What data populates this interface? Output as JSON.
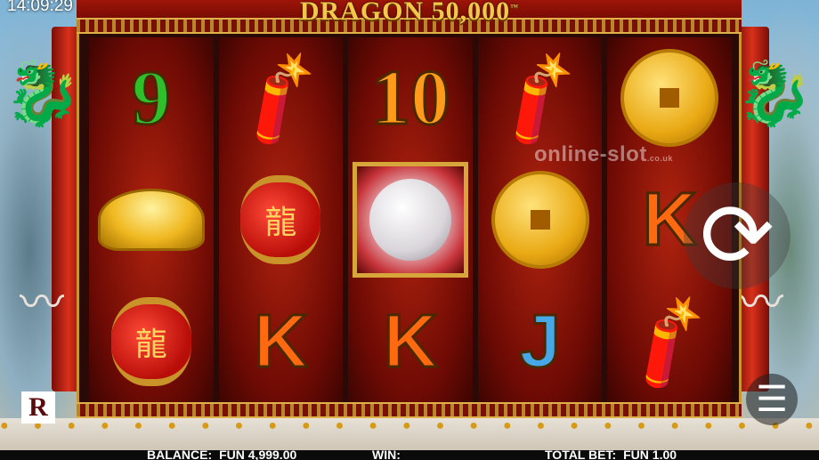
{
  "clock": "14:09:29",
  "game": {
    "title": "DRAGON 50,000",
    "trademark": "™"
  },
  "watermark": {
    "text": "online-slot",
    "suffix": ".co.uk"
  },
  "reels": [
    [
      {
        "kind": "number",
        "text": "9",
        "color": "green"
      },
      {
        "kind": "icon",
        "icon": "gold-ingot-icon"
      },
      {
        "kind": "icon",
        "icon": "lantern-icon"
      }
    ],
    [
      {
        "kind": "icon",
        "icon": "firecracker-icon"
      },
      {
        "kind": "icon",
        "icon": "lantern-icon"
      },
      {
        "kind": "letter",
        "text": "K",
        "color": "orange"
      }
    ],
    [
      {
        "kind": "number",
        "text": "10",
        "color": "orange"
      },
      {
        "kind": "icon",
        "icon": "pearl-icon"
      },
      {
        "kind": "letter",
        "text": "K",
        "color": "orange"
      }
    ],
    [
      {
        "kind": "icon",
        "icon": "firecracker-icon"
      },
      {
        "kind": "icon",
        "icon": "gold-coin-icon"
      },
      {
        "kind": "letter",
        "text": "J",
        "color": "blue"
      }
    ],
    [
      {
        "kind": "icon",
        "icon": "gold-coin-icon"
      },
      {
        "kind": "letter",
        "text": "K",
        "color": "orange"
      },
      {
        "kind": "icon",
        "icon": "firecracker-icon"
      }
    ]
  ],
  "lantern_glyph": "龍",
  "logo_letter": "R",
  "status_bar": {
    "balance_label": "BALANCE:",
    "balance_value": "FUN 4,999.00",
    "win_label": "WIN:",
    "win_value": "",
    "total_bet_label": "TOTAL BET:",
    "total_bet_value": "FUN 1.00"
  },
  "colors": {
    "accent_gold": "#c8962f",
    "frame_red": "#9e1408"
  }
}
